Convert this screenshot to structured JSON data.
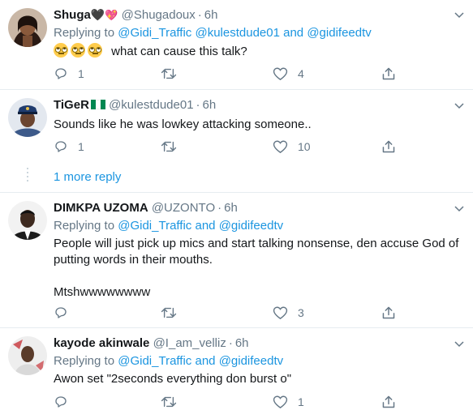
{
  "tweets": [
    {
      "name": "Shuga",
      "handle": "@Shugadoux",
      "time": "6h",
      "replying_prefix": "Replying to",
      "replying_to": [
        "@Gidi_Traffic",
        "@kulestdude01",
        "@gidifeedtv"
      ],
      "connector": "and",
      "text": "what can cause this talk?",
      "replies": "1",
      "retweets": "",
      "likes": "4"
    },
    {
      "name": "TiGeR",
      "handle": "@kulestdude01",
      "time": "6h",
      "text": "Sounds like he was lowkey attacking someone..",
      "replies": "1",
      "retweets": "",
      "likes": "10"
    },
    {
      "name": "DIMKPA UZOMA",
      "handle": "@UZONTO",
      "time": "6h",
      "replying_prefix": "Replying to",
      "replying_to": [
        "@Gidi_Traffic",
        "@gidifeedtv"
      ],
      "connector": "and",
      "text": "People will just pick up mics and start talking nonsense, den accuse God of putting words in their mouths.",
      "text2": "Mtshwwwwwwww",
      "replies": "",
      "retweets": "",
      "likes": "3"
    },
    {
      "name": "kayode akinwale",
      "handle": "@I_am_velliz",
      "time": "6h",
      "replying_prefix": "Replying to",
      "replying_to": [
        "@Gidi_Traffic",
        "@gidifeedtv"
      ],
      "connector": "and",
      "text": "Awon set \"2seconds everything don burst o\"",
      "replies": "",
      "retweets": "",
      "likes": "1"
    }
  ],
  "more_reply": "1 more reply",
  "colors": {
    "link": "#1b95e0",
    "muted": "#657786",
    "divider": "#e6ecf0"
  }
}
